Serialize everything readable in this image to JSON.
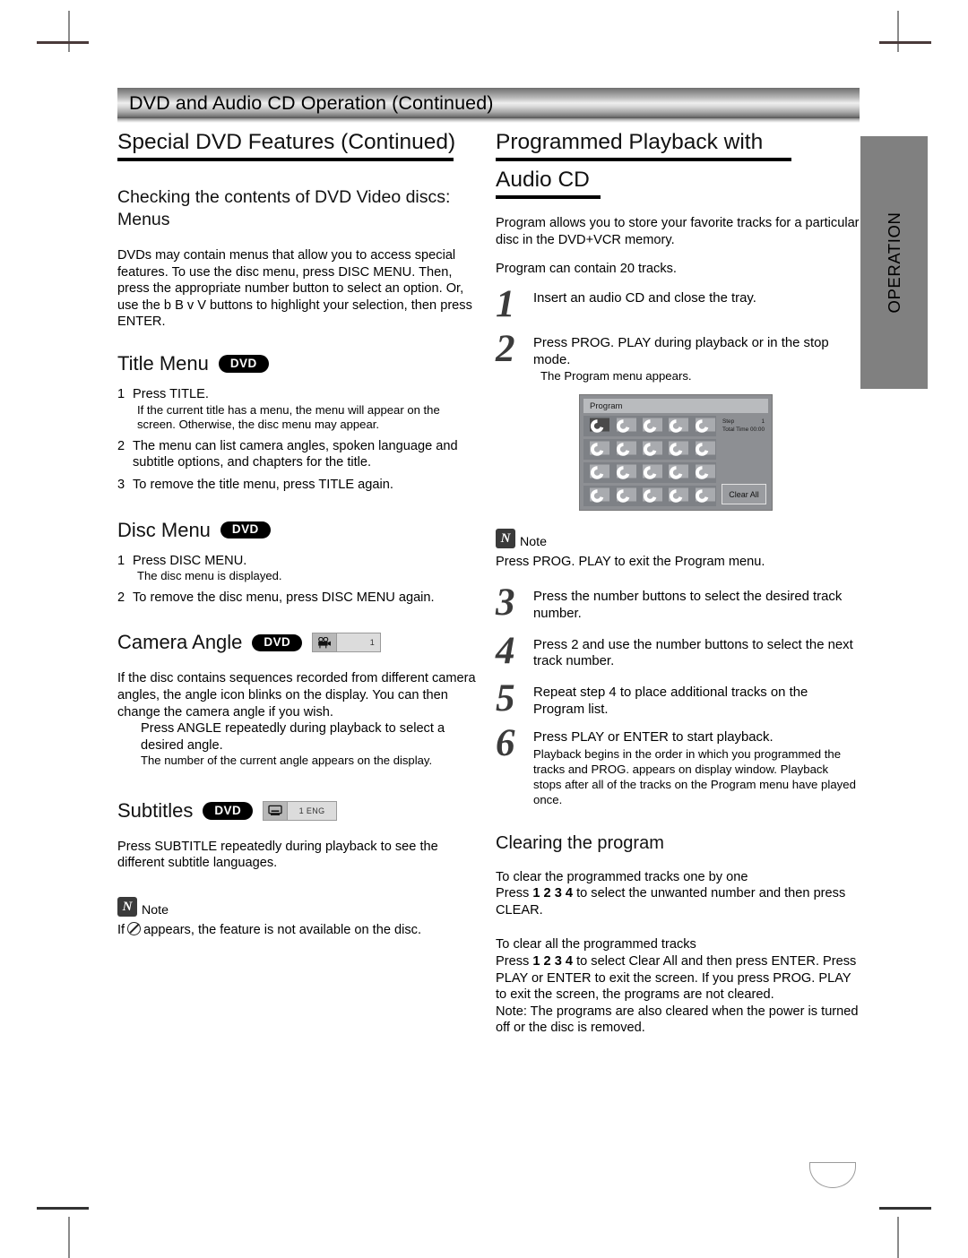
{
  "banner": {
    "title": "DVD and Audio CD Operation (Continued)"
  },
  "side_tab": {
    "label": "OPERATION"
  },
  "page_number": "",
  "left_column": {
    "section_title": "Special DVD Features (Continued)",
    "subsection_title": "Checking the contents of DVD Video discs: Menus",
    "intro_paragraph": "DVDs may contain menus that allow you to access special features. To use the disc menu, press DISC MENU. Then, press the appropriate number button to select an option. Or, use the b B v V   buttons to highlight your selection, then press ENTER.",
    "title_menu": {
      "heading": "Title Menu",
      "badge": "DVD",
      "steps": [
        {
          "n": "1",
          "text": "Press TITLE.",
          "sub": "If the current title has a menu, the menu will appear on the screen. Otherwise, the disc menu may appear."
        },
        {
          "n": "2",
          "text": "The menu can list camera angles, spoken language and subtitle options, and chapters for the title.",
          "sub": ""
        },
        {
          "n": "3",
          "text": "To remove the title menu, press TITLE again.",
          "sub": ""
        }
      ]
    },
    "disc_menu": {
      "heading": "Disc Menu",
      "badge": "DVD",
      "steps": [
        {
          "n": "1",
          "text": "Press DISC MENU.",
          "sub": "The disc menu is displayed."
        },
        {
          "n": "2",
          "text": "To remove the disc menu, press DISC MENU again.",
          "sub": ""
        }
      ]
    },
    "camera_angle": {
      "heading": "Camera Angle",
      "badge": "DVD",
      "osd_value": "1",
      "paragraph": "If the disc contains sequences recorded from different camera angles, the angle icon blinks on the display. You can then change the camera angle if you wish.",
      "indented": "Press ANGLE repeatedly during playback to select a desired angle.",
      "indented_small": "The number of the current angle appears on the display."
    },
    "subtitles": {
      "heading": "Subtitles",
      "badge": "DVD",
      "osd_value": "1  ENG",
      "paragraph": "Press SUBTITLE repeatedly during playback to see the different subtitle languages.",
      "note_label": "Note",
      "note_icon_letter": "N",
      "note_text_before": "If",
      "note_text_after": "appears, the feature is not available on the disc."
    }
  },
  "right_column": {
    "section_title_line1": "Programmed Playback with",
    "section_title_line2": "Audio CD",
    "intro_paragraph": "Program allows you to store your favorite tracks for a particular disc in the DVD+VCR memory.",
    "capacity_paragraph": "Program can contain 20 tracks.",
    "steps": [
      {
        "n": "1",
        "text": "Insert an audio CD and close the tray.",
        "sub": ""
      },
      {
        "n": "2",
        "text": "Press PROG. PLAY during playback or in the stop mode.",
        "sub": "The Program menu appears."
      },
      {
        "n": "3",
        "text": "Press the number buttons to select the desired track number.",
        "sub": ""
      },
      {
        "n": "4",
        "text": "Press 2  and use the number buttons to select the next track number.",
        "sub": ""
      },
      {
        "n": "5",
        "text": "Repeat step 4 to place additional tracks on the Program list.",
        "sub": ""
      },
      {
        "n": "6",
        "text": "Press PLAY or ENTER to start playback.",
        "sub": "Playback begins in the order in which you programmed the tracks and  PROG.  appears on display window. Playback stops after all of the tracks on the Program menu have played once."
      }
    ],
    "program_screen": {
      "title": "Program",
      "step_label": "Step",
      "step_value": "1",
      "total_time_label": "Total Time",
      "total_time_value": "00:00",
      "clear_all_label": "Clear All",
      "grid_rows": 4,
      "grid_cols": 5
    },
    "note": {
      "icon_letter": "N",
      "label": "Note",
      "text": "Press PROG. PLAY to exit the Program menu."
    },
    "clearing": {
      "heading": "Clearing the program",
      "one_by_one_title": "To clear the programmed tracks one by one",
      "one_by_one_text_pre": "Press",
      "one_by_one_keys": "1  2  3  4",
      "one_by_one_text_post": "to select the unwanted number and then press CLEAR.",
      "all_title": "To clear all the programmed tracks",
      "all_text_pre": "Press",
      "all_keys": "1  2  3  4",
      "all_text_post": "to select  Clear All  and then press ENTER. Press PLAY or ENTER to exit the screen. If you press PROG. PLAY to exit the screen, the programs are not cleared.",
      "footnote": "Note: The programs are also cleared when the power is turned off or the disc is removed."
    }
  }
}
